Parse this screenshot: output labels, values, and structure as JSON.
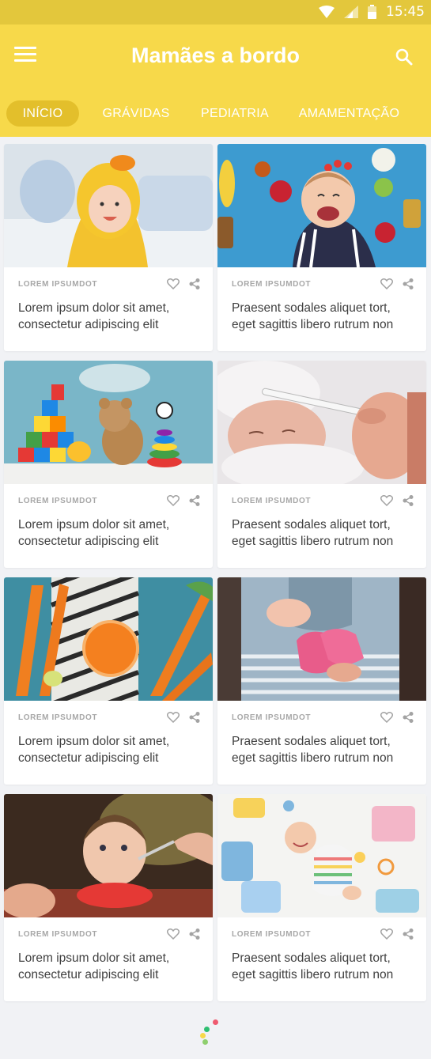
{
  "status_bar": {
    "time": "15:45",
    "icons": [
      "wifi-icon",
      "signal-icon",
      "battery-icon"
    ]
  },
  "app_bar": {
    "title": "Mamães a bordo",
    "menu_icon": "menu-icon",
    "search_icon": "search-icon"
  },
  "tabs": [
    {
      "label": "INÍCIO",
      "active": true
    },
    {
      "label": "GRÁVIDAS",
      "active": false
    },
    {
      "label": "PEDIATRIA",
      "active": false
    },
    {
      "label": "AMAMENTAÇÃO",
      "active": false
    }
  ],
  "cards": [
    {
      "category": "LOREM IPSUMDOT",
      "text": "Lorem ipsum dolor sit amet, consectetur adipiscing elit",
      "image": "baby-in-duck-towel"
    },
    {
      "category": "LOREM IPSUMDOT",
      "text": "Praesent sodales aliquet  tort, eget sagittis libero rutrum non",
      "image": "baby-with-vegetables"
    },
    {
      "category": "LOREM IPSUMDOT",
      "text": "Lorem ipsum dolor sit amet, consectetur adipiscing elit",
      "image": "toys-and-teddy-bear"
    },
    {
      "category": "LOREM IPSUMDOT",
      "text": "Praesent sodales aliquet  tort, eget sagittis libero rutrum non",
      "image": "baby-with-thermometer"
    },
    {
      "category": "LOREM IPSUMDOT",
      "text": "Lorem ipsum dolor sit amet, consectetur adipiscing elit",
      "image": "carrots-and-juice"
    },
    {
      "category": "LOREM IPSUMDOT",
      "text": "Praesent sodales aliquet  tort, eget sagittis libero rutrum non",
      "image": "pregnant-with-baby-shoes"
    },
    {
      "category": "LOREM IPSUMDOT",
      "text": "Lorem ipsum dolor sit amet, consectetur adipiscing elit",
      "image": "baby-eating"
    },
    {
      "category": "LOREM IPSUMDOT",
      "text": "Praesent sodales aliquet  tort, eget sagittis libero rutrum non",
      "image": "baby-with-clothes"
    }
  ],
  "colors": {
    "primary": "#f7d94a",
    "status_bar": "#e3c73c",
    "active_tab": "#e3bf2b",
    "background": "#f1f2f5"
  },
  "loader": {
    "icon": "loading-dots-icon"
  }
}
